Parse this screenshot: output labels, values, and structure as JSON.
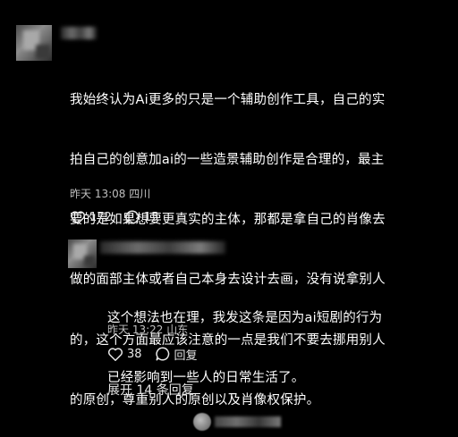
{
  "comment": {
    "text": "我始终认为Ai更多的只是一个辅助创作工具，自己的实拍自己的创意加ai的一些造景辅助创作是合理的，最主要的是如果想要更真实的主体，那都是拿自己的肖像去做的面部主体或者自己本身去设计去画，没有说拿别人的，这个方面最应该注意的一点是我们不要去挪用别人的原创，尊重别人的原创以及肖像权保护。",
    "lines": [
      "我始终认为Ai更多的只是一个辅助创作工具，自己的实",
      "拍自己的创意加ai的一些造景辅助创作是合理的，最主",
      "要的是如果想要更真实的主体，那都是拿自己的肖像去",
      "做的面部主体或者自己本身去设计去画，没有说拿别人",
      "的，这个方面最应该注意的一点是我们不要去挪用别人",
      "的原创，尊重别人的原创以及肖像权保护。"
    ],
    "meta": "昨天 13:08 四川",
    "likes": "172",
    "replies": "15"
  },
  "reply": {
    "lines": [
      "这个想法也在理，我发这条是因为ai短剧的行为",
      "已经影响到一些人的日常生活了。"
    ],
    "meta": "昨天 13:22 山东",
    "likes": "38",
    "reply_label": "回复"
  },
  "expand_label": "展开 14 条回复",
  "colors": {
    "background": "#000000",
    "text": "#ffffff",
    "meta": "#bfbfbf"
  }
}
